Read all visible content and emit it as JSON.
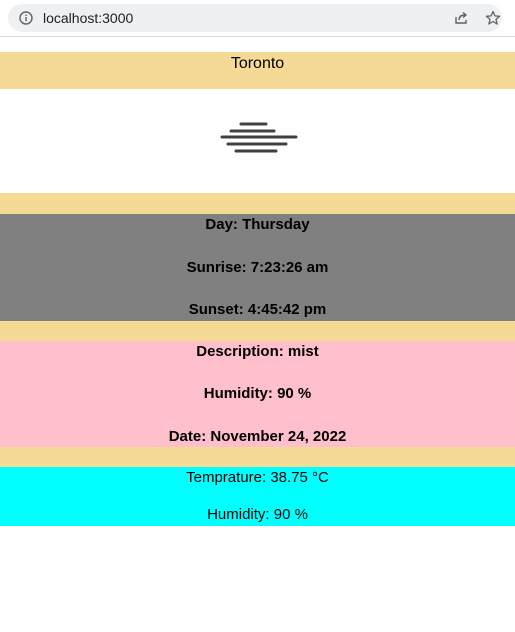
{
  "browser": {
    "url": "localhost:3000"
  },
  "weather": {
    "city": "Toronto",
    "icon": "mist-icon",
    "day": "Day: Thursday",
    "sunrise": "Sunrise: 7:23:26 am",
    "sunset": "Sunset: 4:45:42 pm",
    "description": "Description: mist",
    "humidity_bold": "Humidity: 90 %",
    "date": "Date: November 24, 2022",
    "temperature": "Temprature: 38.75 °C",
    "humidity": "Humidity: 90 %"
  },
  "colors": {
    "tan": "#f5da96",
    "grey": "#808080",
    "pink": "#ffc0cb",
    "cyan": "#00ffff"
  }
}
